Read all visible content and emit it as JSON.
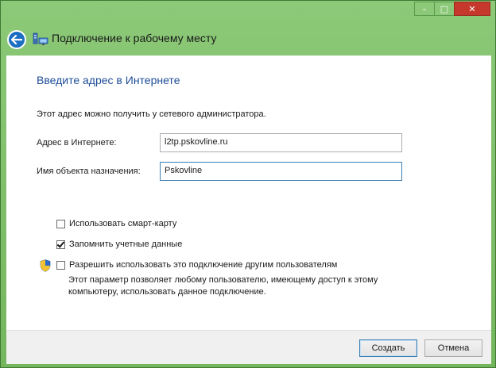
{
  "window": {
    "title": "Подключение к рабочему месту",
    "caption_buttons": {
      "minimize": "–",
      "maximize": "□",
      "close": "✕"
    },
    "accent_color": "#7fbd6a"
  },
  "content": {
    "heading": "Введите адрес в Интернете",
    "info": "Этот адрес можно получить у сетевого администратора.",
    "internet_address": {
      "label": "Адрес в Интернете:",
      "value": "l2tp.pskovline.ru"
    },
    "destination_name": {
      "label": "Имя объекта назначения:",
      "value": "Pskovline"
    },
    "checkboxes": [
      {
        "label": "Использовать смарт-карту",
        "checked": false
      },
      {
        "label": "Запомнить учетные данные",
        "checked": true
      },
      {
        "label": "Разрешить использовать это подключение другим пользователям",
        "checked": false
      }
    ],
    "description": "Этот параметр позволяет любому пользователю, имеющему доступ к этому компьютеру, использовать данное подключение."
  },
  "footer": {
    "create_label": "Создать",
    "cancel_label": "Отмена"
  }
}
